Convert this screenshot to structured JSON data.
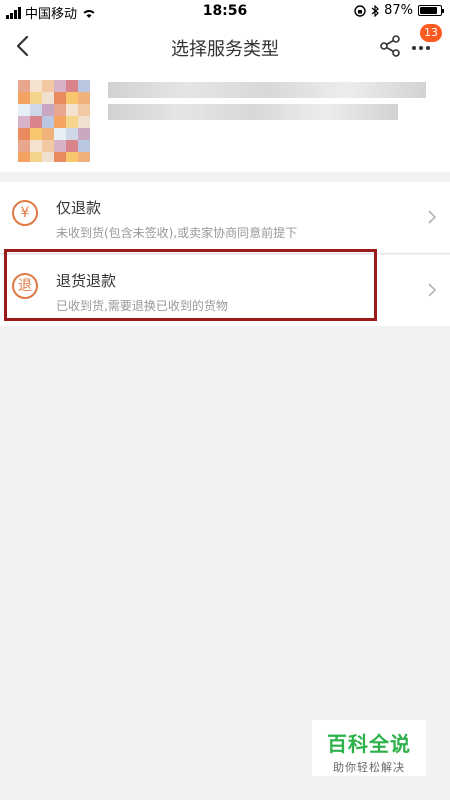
{
  "status_bar": {
    "carrier": "中国移动",
    "time": "18:56",
    "battery": "87%",
    "battery_level": 0.87
  },
  "nav": {
    "title": "选择服务类型",
    "notification_count": "13",
    "icons": {
      "back": "back-arrow-icon",
      "share": "share-icon",
      "more": "more-icon"
    }
  },
  "options": [
    {
      "title": "仅退款",
      "description": "未收到货(包含未签收),或卖家协商同意前提下",
      "icon_char": "¥",
      "icon": "refund-only-icon"
    },
    {
      "title": "退货退款",
      "description": "已收到货,需要退换已收到的货物",
      "icon_char": "退",
      "icon": "return-refund-icon"
    }
  ],
  "watermark": {
    "main": "百科全说",
    "sub": "助你轻松解决"
  },
  "colors": {
    "accent": "#e07a44",
    "badge": "#ff5a1f",
    "highlight": "#9b1b1b",
    "watermark": "#2db24a"
  }
}
